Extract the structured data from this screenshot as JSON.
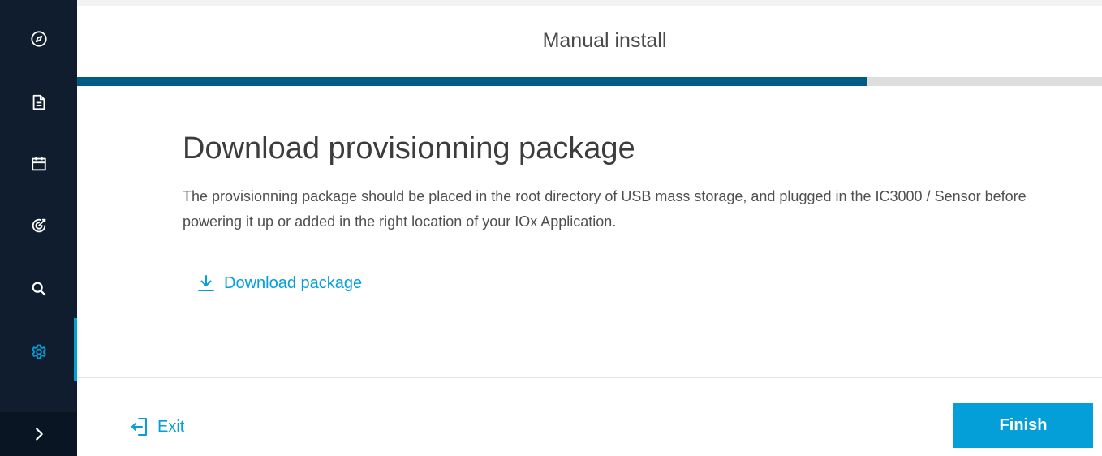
{
  "sidebar": {
    "items": [
      {
        "icon": "compass-icon",
        "active": false
      },
      {
        "icon": "document-icon",
        "active": false
      },
      {
        "icon": "calendar-icon",
        "active": false
      },
      {
        "icon": "target-icon",
        "active": false
      },
      {
        "icon": "search-icon",
        "active": false
      },
      {
        "icon": "gear-icon",
        "active": true
      }
    ],
    "expand_icon": "chevron-right-icon"
  },
  "header": {
    "title": "Manual install",
    "progress": 0.77
  },
  "main": {
    "heading": "Download provisionning package",
    "description": "The provisionning package should be placed in the root directory of USB mass storage, and plugged in the IC3000 / Sensor before powering it up or added in the right location of your IOx Application.",
    "download_link": {
      "label": "Download package",
      "icon": "download-icon"
    }
  },
  "footer": {
    "exit_label": "Exit",
    "exit_icon": "exit-icon",
    "finish_label": "Finish"
  },
  "colors": {
    "sidebar_bg": "#0f1d2f",
    "accent": "#049fd9",
    "progress_fill": "#005c84",
    "progress_track": "#dedede"
  }
}
